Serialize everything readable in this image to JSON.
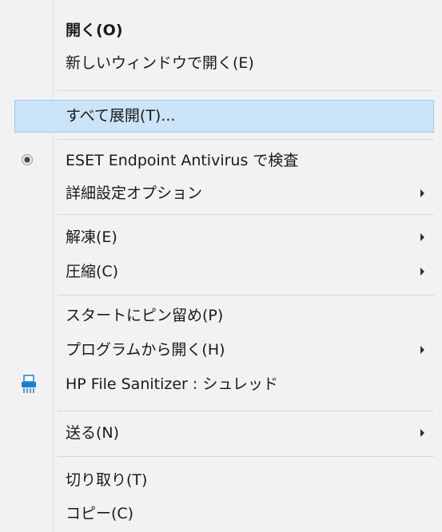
{
  "menu": {
    "open": "開く(O)",
    "open_new_window": "新しいウィンドウで開く(E)",
    "extract_all": "すべて展開(T)...",
    "eset_scan": "ESET Endpoint Antivirus で検査",
    "advanced_options": "詳細設定オプション",
    "decompress": "解凍(E)",
    "compress": "圧縮(C)",
    "pin_to_start": "スタートにピン留め(P)",
    "open_with": "プログラムから開く(H)",
    "hp_shred": "HP File Sanitizer : シュレッド",
    "send_to": "送る(N)",
    "cut": "切り取り(T)",
    "copy": "コピー(C)"
  },
  "icons": {
    "eset": "radio-target-icon",
    "hp": "shredder-icon"
  },
  "colors": {
    "highlight": "#cce4f7",
    "highlight_border": "#99c9ef",
    "hp_icon": "#1b7fd1"
  }
}
